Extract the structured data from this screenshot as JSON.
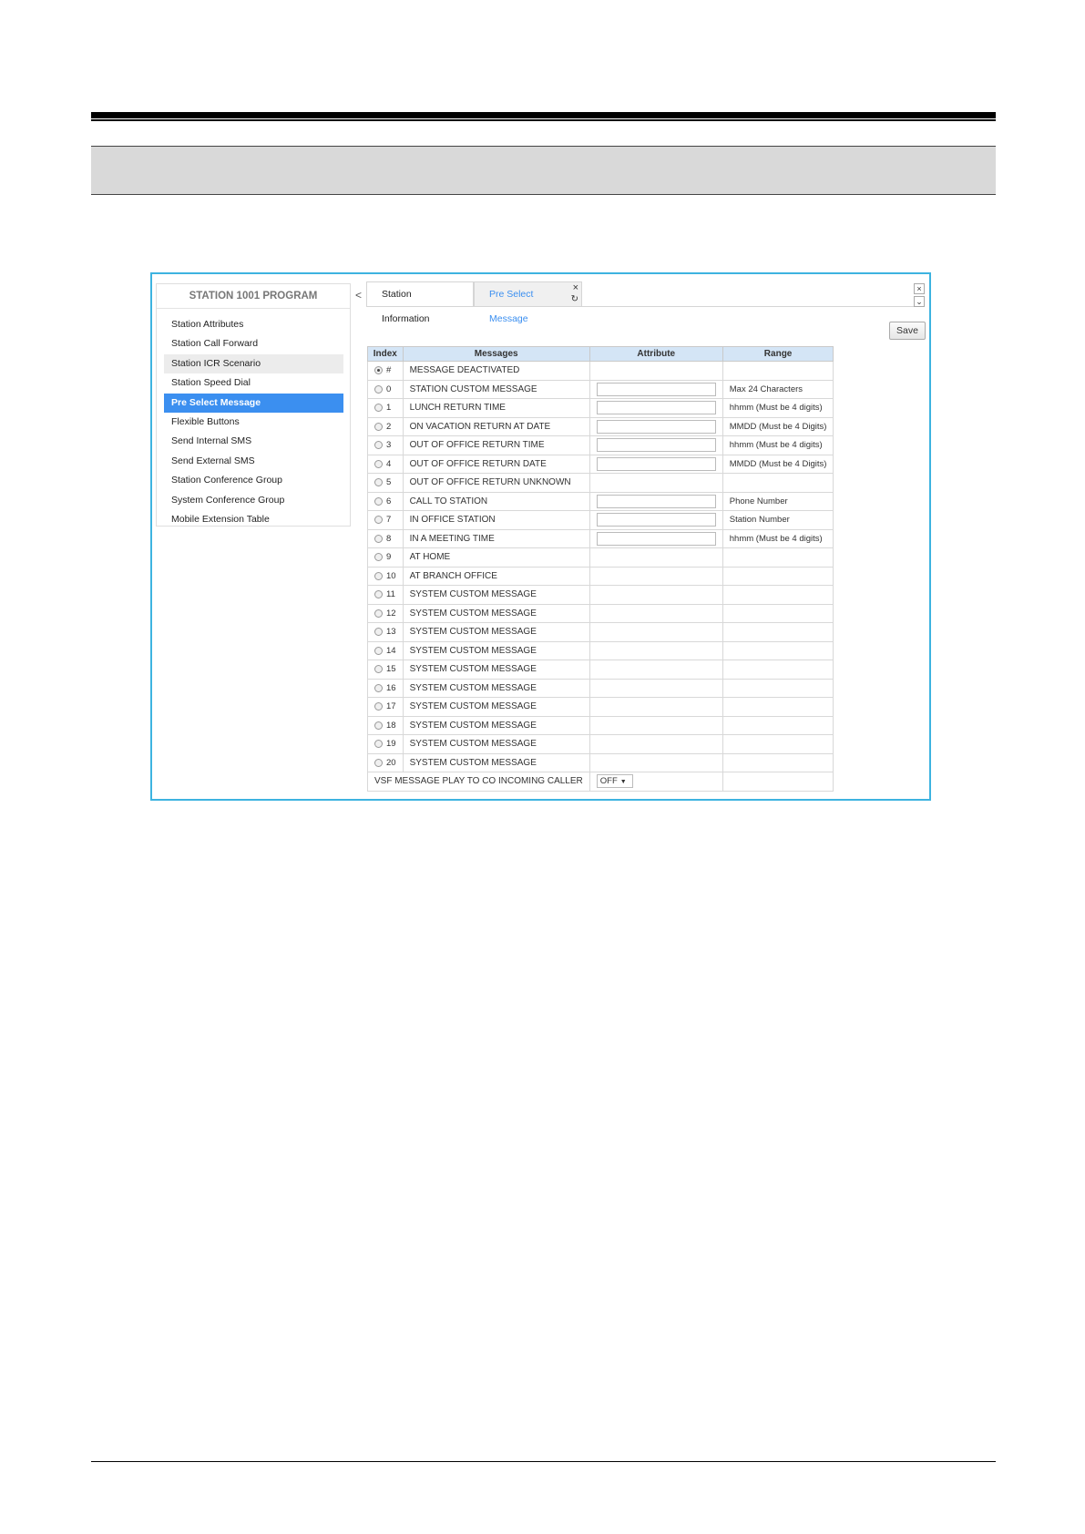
{
  "sidebar": {
    "title": "STATION 1001 PROGRAM",
    "items": [
      {
        "label": "Station Attributes"
      },
      {
        "label": "Station Call Forward"
      },
      {
        "label": "Station ICR Scenario"
      },
      {
        "label": "Station Speed Dial"
      },
      {
        "label": "Pre Select Message"
      },
      {
        "label": "Flexible Buttons"
      },
      {
        "label": "Send Internal SMS"
      },
      {
        "label": "Send External SMS"
      },
      {
        "label": "Station Conference Group"
      },
      {
        "label": "System Conference Group"
      },
      {
        "label": "Mobile Extension Table"
      }
    ],
    "active_item": "Pre Select Message"
  },
  "tabs": {
    "chevron": "<",
    "items": [
      {
        "label": "Station Information"
      },
      {
        "label": "Pre Select Message"
      }
    ],
    "close_glyph": "×",
    "refresh_glyph": "↻"
  },
  "window": {
    "close_glyph": "×",
    "down_glyph": "⌄"
  },
  "toolbar": {
    "save_label": "Save"
  },
  "table": {
    "headers": {
      "index": "Index",
      "messages": "Messages",
      "attribute": "Attribute",
      "range": "Range"
    },
    "rows": [
      {
        "index": "#",
        "message": "MESSAGE DEACTIVATED",
        "has_input": false,
        "range": "",
        "selected": true
      },
      {
        "index": "0",
        "message": "STATION CUSTOM MESSAGE",
        "has_input": true,
        "range": "Max 24 Characters"
      },
      {
        "index": "1",
        "message": "LUNCH RETURN TIME",
        "has_input": true,
        "range": "hhmm (Must be 4 digits)"
      },
      {
        "index": "2",
        "message": "ON VACATION RETURN AT DATE",
        "has_input": true,
        "range": "MMDD (Must be 4 Digits)"
      },
      {
        "index": "3",
        "message": "OUT OF OFFICE RETURN TIME",
        "has_input": true,
        "range": "hhmm (Must be 4 digits)"
      },
      {
        "index": "4",
        "message": "OUT OF OFFICE RETURN DATE",
        "has_input": true,
        "range": "MMDD (Must be 4 Digits)"
      },
      {
        "index": "5",
        "message": "OUT OF OFFICE RETURN UNKNOWN",
        "has_input": false,
        "range": ""
      },
      {
        "index": "6",
        "message": "CALL TO STATION",
        "has_input": true,
        "range": "Phone Number"
      },
      {
        "index": "7",
        "message": "IN OFFICE STATION",
        "has_input": true,
        "range": "Station Number"
      },
      {
        "index": "8",
        "message": "IN A MEETING TIME",
        "has_input": true,
        "range": "hhmm (Must be 4 digits)"
      },
      {
        "index": "9",
        "message": "AT HOME",
        "has_input": false,
        "range": ""
      },
      {
        "index": "10",
        "message": "AT BRANCH OFFICE",
        "has_input": false,
        "range": ""
      },
      {
        "index": "11",
        "message": "SYSTEM CUSTOM MESSAGE",
        "has_input": false,
        "range": ""
      },
      {
        "index": "12",
        "message": "SYSTEM CUSTOM MESSAGE",
        "has_input": false,
        "range": ""
      },
      {
        "index": "13",
        "message": "SYSTEM CUSTOM MESSAGE",
        "has_input": false,
        "range": ""
      },
      {
        "index": "14",
        "message": "SYSTEM CUSTOM MESSAGE",
        "has_input": false,
        "range": ""
      },
      {
        "index": "15",
        "message": "SYSTEM CUSTOM MESSAGE",
        "has_input": false,
        "range": ""
      },
      {
        "index": "16",
        "message": "SYSTEM CUSTOM MESSAGE",
        "has_input": false,
        "range": ""
      },
      {
        "index": "17",
        "message": "SYSTEM CUSTOM MESSAGE",
        "has_input": false,
        "range": ""
      },
      {
        "index": "18",
        "message": "SYSTEM CUSTOM MESSAGE",
        "has_input": false,
        "range": ""
      },
      {
        "index": "19",
        "message": "SYSTEM CUSTOM MESSAGE",
        "has_input": false,
        "range": ""
      },
      {
        "index": "20",
        "message": "SYSTEM CUSTOM MESSAGE",
        "has_input": false,
        "range": ""
      }
    ],
    "vsf": {
      "label": "VSF MESSAGE PLAY TO CO INCOMING CALLER",
      "value": "OFF",
      "caret": "▼"
    }
  },
  "colors": {
    "accent": "#3b8ff0",
    "frame_border": "#3db3e0",
    "header_bg": "#d4e5f6"
  }
}
